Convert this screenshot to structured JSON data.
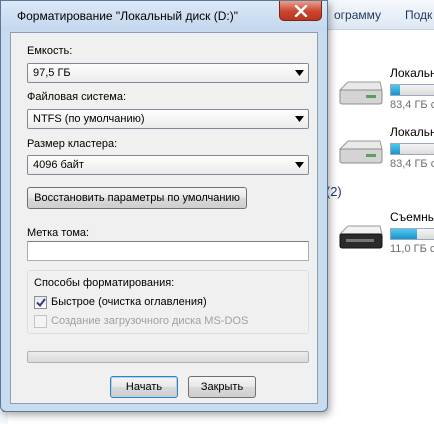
{
  "background": {
    "menu_left": "ограмму",
    "menu_right": "Подк",
    "section_label": "и (2)",
    "left_labels": [
      "(",
      "("
    ],
    "drives": [
      {
        "name": "Локальн",
        "free": "83,4 ГБ с",
        "fill": 0.15
      },
      {
        "name": "Локальн",
        "free": "83,4 ГБ с",
        "fill": 0.15
      },
      {
        "name": "Съемны",
        "free": "11,0 ГБ с",
        "fill": 0.45
      }
    ],
    "bar_color": "#2aa6d8"
  },
  "dialog": {
    "title": "Форматирование \"Локальный диск (D:)\"",
    "close_icon": "close-icon",
    "capacity": {
      "label": "Емкость:",
      "value": "97,5 ГБ"
    },
    "filesystem": {
      "label": "Файловая система:",
      "value": "NTFS (по умолчанию)"
    },
    "cluster": {
      "label": "Размер кластера:",
      "value": "4096 байт"
    },
    "restore_defaults_label": "Восстановить параметры по умолчанию",
    "volume_label": {
      "label": "Метка тома:",
      "value": ""
    },
    "format_options": {
      "title": "Способы форматирования:",
      "quick": {
        "label": "Быстрое (очистка оглавления)",
        "checked": true
      },
      "msdos": {
        "label": "Создание загрузочного диска MS-DOS",
        "checked": false,
        "disabled": true
      }
    },
    "progress": 0,
    "start_label": "Начать",
    "close_label": "Закрыть"
  }
}
